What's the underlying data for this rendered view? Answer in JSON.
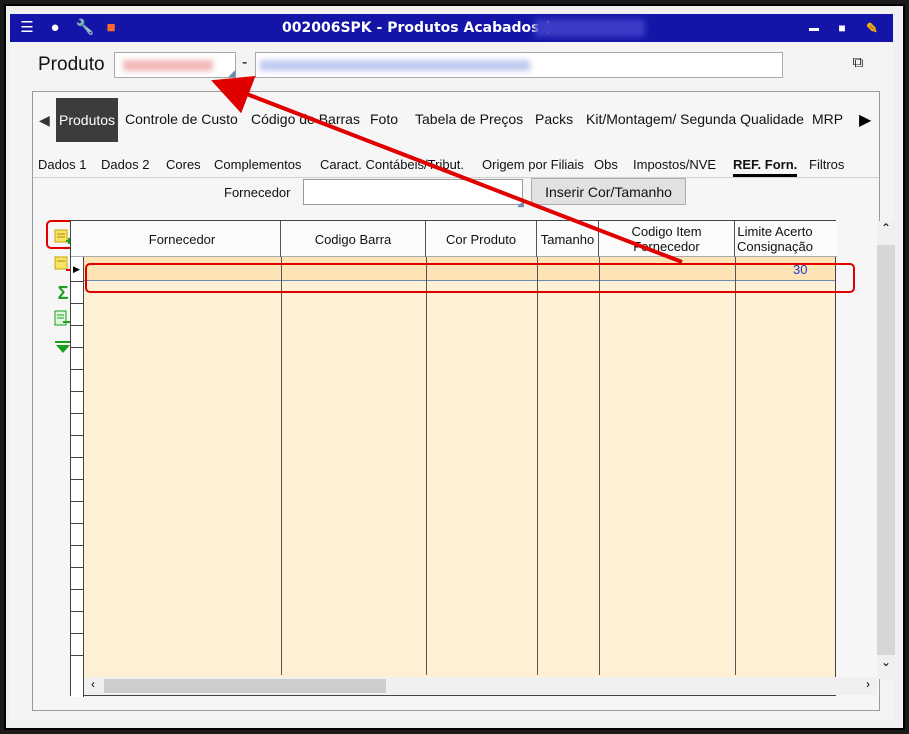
{
  "window": {
    "title": "002006SPK - Produtos Acabados (",
    "minimize": "▬",
    "maximize": "■"
  },
  "header": {
    "produto_label": "Produto",
    "dash": "-"
  },
  "main_tabs": [
    {
      "label": "Produtos",
      "active": true
    },
    {
      "label": "Controle de Custo"
    },
    {
      "label": "Código de Barras"
    },
    {
      "label": "Foto"
    },
    {
      "label": "Tabela de Preços"
    },
    {
      "label": "Packs"
    },
    {
      "label": "Kit/Montagem/ Segunda Qualidade"
    },
    {
      "label": "MRP"
    }
  ],
  "sub_tabs": [
    {
      "label": "Dados 1"
    },
    {
      "label": "Dados 2"
    },
    {
      "label": "Cores"
    },
    {
      "label": "Complementos"
    },
    {
      "label": "Caract. Contábeis/Tribut."
    },
    {
      "label": "Origem por Filiais"
    },
    {
      "label": "Obs"
    },
    {
      "label": "Impostos/NVE"
    },
    {
      "label": "REF. Forn.",
      "active": true
    },
    {
      "label": "Filtros"
    }
  ],
  "fornecedor": {
    "label": "Fornecedor",
    "value": "",
    "insert_button": "Inserir Cor/Tamanho"
  },
  "side_toolbar": [
    {
      "icon": "add-record-icon",
      "highlighted": true
    },
    {
      "icon": "remove-record-icon"
    },
    {
      "icon": "sum-icon"
    },
    {
      "icon": "export-icon"
    },
    {
      "icon": "filter-icon"
    }
  ],
  "grid": {
    "columns": [
      {
        "label": "Fornecedor"
      },
      {
        "label": "Codigo Barra"
      },
      {
        "label": "Cor Produto"
      },
      {
        "label": "Tamanho"
      },
      {
        "label": "Codigo  Item\nFornecedor"
      },
      {
        "label": "Limite Acerto\nConsignação"
      }
    ],
    "rows": [
      {
        "fornecedor": "",
        "codigo_barra": "",
        "cor_produto": "",
        "tamanho": "",
        "codigo_item": "",
        "limite": "30"
      }
    ]
  },
  "colors": {
    "titlebar": "#1414a8",
    "annotation": "#e00000",
    "grid_bg": "#fdf0d5",
    "selected_row": "#fde3b6"
  }
}
